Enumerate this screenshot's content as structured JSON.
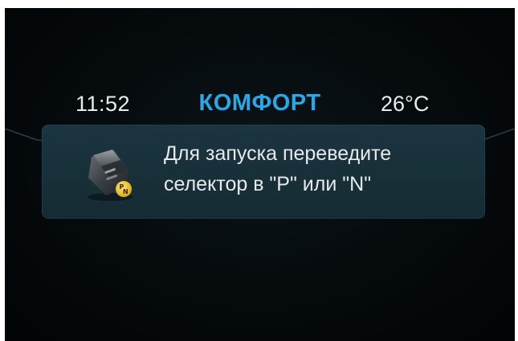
{
  "status_bar": {
    "time": "11:52",
    "mode": "КОМФОРТ",
    "temperature": "26°C"
  },
  "notification": {
    "icon": "gear-selector-pn-icon",
    "icon_badge": "PN",
    "message_line1": "Для запуска переведите",
    "message_line2": "селектор в \"P\" или \"N\""
  },
  "colors": {
    "mode_accent": "#29a8e8",
    "text": "#e6eaec",
    "panel": "#1a313b",
    "background": "#050a0c"
  }
}
